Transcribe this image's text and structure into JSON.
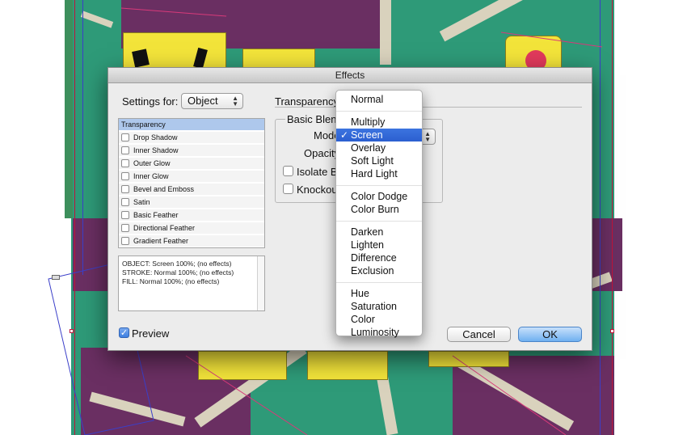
{
  "dialog": {
    "title": "Effects",
    "settings_for_label": "Settings for:",
    "settings_for_value": "Object",
    "effects": [
      {
        "label": "Transparency",
        "checked": null,
        "selected": true
      },
      {
        "label": "Drop Shadow",
        "checked": false
      },
      {
        "label": "Inner Shadow",
        "checked": false
      },
      {
        "label": "Outer Glow",
        "checked": false
      },
      {
        "label": "Inner Glow",
        "checked": false
      },
      {
        "label": "Bevel and Emboss",
        "checked": false
      },
      {
        "label": "Satin",
        "checked": false
      },
      {
        "label": "Basic Feather",
        "checked": false
      },
      {
        "label": "Directional Feather",
        "checked": false
      },
      {
        "label": "Gradient Feather",
        "checked": false
      }
    ],
    "summary_lines": [
      "OBJECT: Screen 100%; (no effects)",
      "STROKE: Normal 100%; (no effects)",
      "FILL: Normal 100%; (no effects)"
    ],
    "section_title": "Transparency",
    "group_title": "Basic Blend",
    "mode_label": "Mode",
    "opacity_label": "Opacity",
    "isolate_label": "Isolate Bl",
    "knockout_label": "Knockout",
    "preview_label": "Preview",
    "preview_checked": true,
    "cancel_label": "Cancel",
    "ok_label": "OK"
  },
  "blend_menu": {
    "selected": "Screen",
    "groups": [
      [
        "Normal"
      ],
      [
        "Multiply",
        "Screen",
        "Overlay",
        "Soft Light",
        "Hard Light"
      ],
      [
        "Color Dodge",
        "Color Burn"
      ],
      [
        "Darken",
        "Lighten",
        "Difference",
        "Exclusion"
      ],
      [
        "Hue",
        "Saturation",
        "Color",
        "Luminosity"
      ]
    ]
  },
  "colors": {
    "accent": "#3c74e0",
    "canvas_green": "#2e9a78",
    "canvas_purple": "#6a2f62",
    "card_yellow": "#f3e43a"
  }
}
